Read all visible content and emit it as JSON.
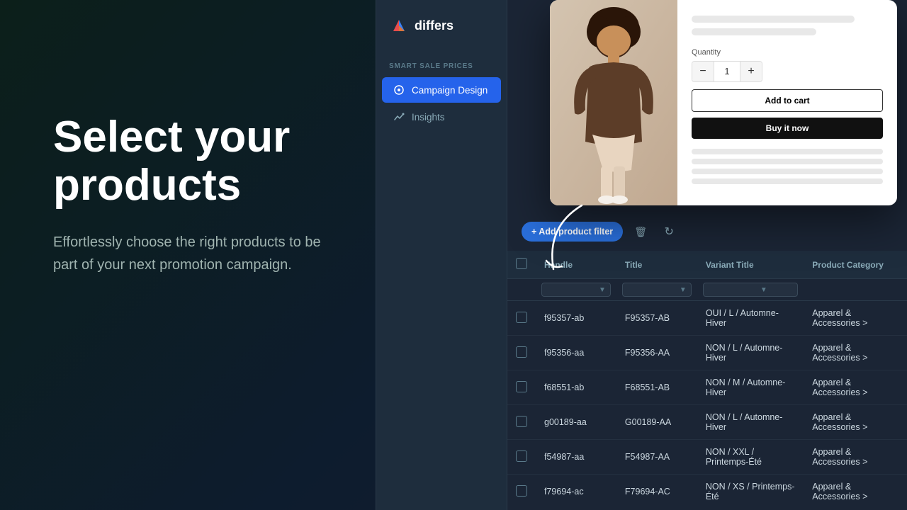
{
  "hero": {
    "title": "Select your products",
    "subtitle": "Effortlessly choose the right products to be part of your next promotion campaign."
  },
  "sidebar": {
    "logo_text": "differs",
    "section_label": "SMART SALE PRICES",
    "items": [
      {
        "id": "campaign-design",
        "label": "Campaign Design",
        "active": true
      },
      {
        "id": "insights",
        "label": "Insights",
        "active": false
      }
    ]
  },
  "product_card": {
    "quantity_label": "Quantity",
    "quantity_value": "1",
    "btn_add_cart": "Add to cart",
    "btn_buy_now": "Buy it now"
  },
  "toolbar": {
    "add_filter_label": "+ Add product filter"
  },
  "table": {
    "columns": [
      "Handle",
      "Title",
      "Variant Title",
      "Product Category"
    ],
    "rows": [
      {
        "handle": "f95357-ab",
        "title": "F95357-AB",
        "variant": "OUI / L / Automne-Hiver",
        "category": "Apparel & Accessories >"
      },
      {
        "handle": "f95356-aa",
        "title": "F95356-AA",
        "variant": "NON / L / Automne-Hiver",
        "category": "Apparel & Accessories >"
      },
      {
        "handle": "f68551-ab",
        "title": "F68551-AB",
        "variant": "NON / M / Automne-Hiver",
        "category": "Apparel & Accessories >"
      },
      {
        "handle": "g00189-aa",
        "title": "G00189-AA",
        "variant": "NON / L / Automne-Hiver",
        "category": "Apparel & Accessories >"
      },
      {
        "handle": "f54987-aa",
        "title": "F54987-AA",
        "variant": "NON / XXL / Printemps-Été",
        "category": "Apparel & Accessories >"
      },
      {
        "handle": "f79694-ac",
        "title": "F79694-AC",
        "variant": "NON / XS / Printemps-Été",
        "category": "Apparel & Accessories >"
      }
    ]
  },
  "icons": {
    "trash": "🗑",
    "refresh": "↻",
    "filter": "⌄",
    "plus": "+"
  }
}
